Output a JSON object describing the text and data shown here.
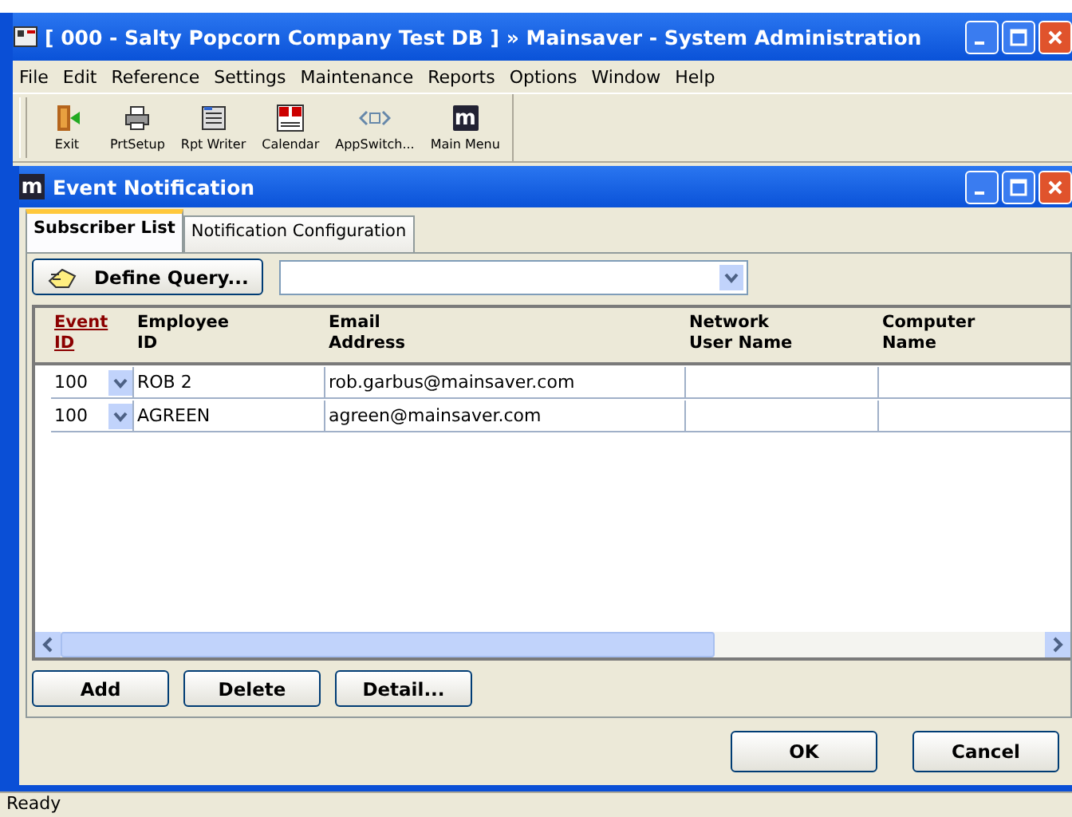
{
  "window": {
    "title": "[ 000 - Salty Popcorn Company Test DB ] » Mainsaver - System Administration"
  },
  "menu": [
    "File",
    "Edit",
    "Reference",
    "Settings",
    "Maintenance",
    "Reports",
    "Options",
    "Window",
    "Help"
  ],
  "toolbar": [
    {
      "kind": "exit",
      "label": "Exit"
    },
    {
      "kind": "printer",
      "label": "PrtSetup"
    },
    {
      "kind": "writer",
      "label": "Rpt Writer"
    },
    {
      "kind": "calendar",
      "label": "Calendar"
    },
    {
      "kind": "switch",
      "label": "AppSwitch..."
    },
    {
      "kind": "logo",
      "label": "Main Menu",
      "glyph": "m"
    }
  ],
  "child_window": {
    "title": "Event Notification",
    "logo": "m",
    "tabs": [
      {
        "label": "Subscriber List",
        "selected": true
      },
      {
        "label": "Notification Configuration",
        "selected": false
      }
    ],
    "query_button": "Define Query...",
    "table": {
      "columns": [
        {
          "lines": [
            "Event",
            "ID"
          ],
          "sorted": true
        },
        {
          "lines": [
            "Employee",
            "ID"
          ],
          "sorted": false
        },
        {
          "lines": [
            "Email",
            "Address"
          ],
          "sorted": false
        },
        {
          "lines": [
            "Network",
            "User Name"
          ],
          "sorted": false
        },
        {
          "lines": [
            "Computer",
            "Name"
          ],
          "sorted": false
        }
      ],
      "rows": [
        {
          "event_id": "100",
          "employee_id": "ROB 2",
          "email": "rob.garbus@mainsaver.com"
        },
        {
          "event_id": "100",
          "employee_id": "AGREEN",
          "email": "agreen@mainsaver.com"
        }
      ]
    },
    "buttons": [
      "Add",
      "Delete",
      "Detail..."
    ],
    "dialog_buttons": [
      "OK",
      "Cancel"
    ]
  },
  "status_bar": "Ready"
}
